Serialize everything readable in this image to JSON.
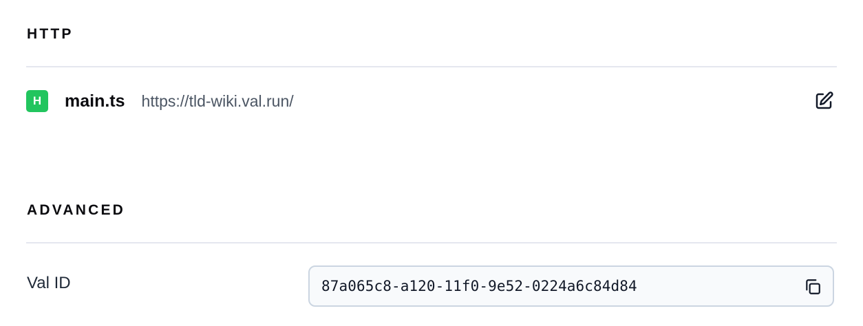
{
  "http": {
    "heading": "HTTP",
    "item": {
      "badge": "H",
      "badge_color": "#22c55e",
      "file_name": "main.ts",
      "url": "https://tld-wiki.val.run/",
      "edit_icon": "edit-icon"
    }
  },
  "advanced": {
    "heading": "ADVANCED",
    "val_id": {
      "label": "Val ID",
      "value": "87a065c8-a120-11f0-9e52-0224a6c84d84",
      "copy_icon": "copy-icon"
    }
  }
}
